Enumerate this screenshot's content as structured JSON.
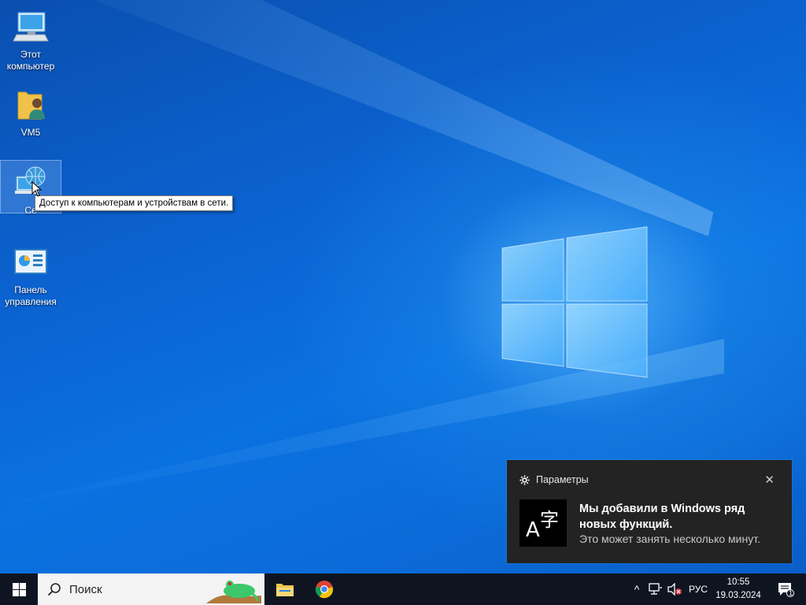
{
  "desktop": {
    "icons": [
      {
        "label": "Этот компьютер"
      },
      {
        "label": "VM5"
      },
      {
        "label": "Се"
      },
      {
        "label": "Панель управления"
      }
    ],
    "tooltip": "Доступ к компьютерам и устройствам в сети."
  },
  "toast": {
    "app_name": "Параметры",
    "title": "Мы добавили в Windows ряд новых функций.",
    "body": "Это может занять несколько минут.",
    "close_glyph": "✕",
    "icon": "language-icon",
    "icon_glyph_a": "A",
    "icon_glyph_b": "字"
  },
  "taskbar": {
    "search_placeholder": "Поиск",
    "apps": [
      "file-explorer-icon",
      "chrome-icon"
    ],
    "tray": {
      "chevron": "^",
      "language": "РУС",
      "time": "10:55",
      "date": "19.03.2024",
      "notification_count": "1"
    }
  },
  "colors": {
    "desktop_blue": "#0a63cf",
    "taskbar": "#0e1521",
    "toast_bg": "#232323"
  }
}
